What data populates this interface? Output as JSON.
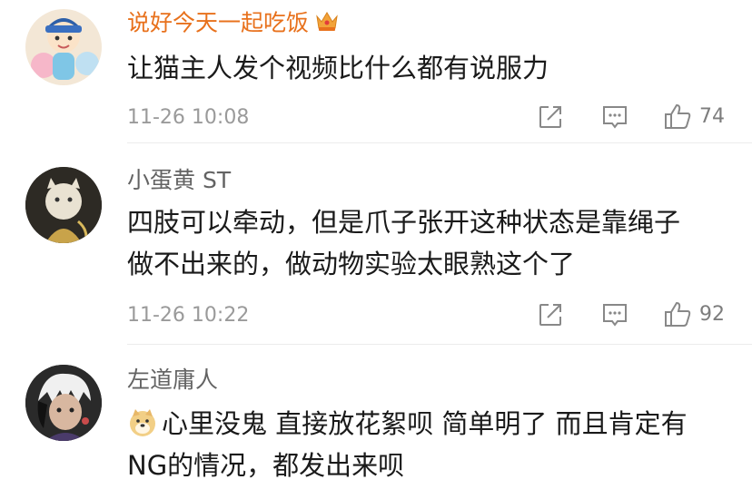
{
  "comments": [
    {
      "username": "说好今天一起吃饭",
      "text_lines": [
        "让猫主人发个视频比什么都有说服力"
      ],
      "timestamp": "11-26 10:08",
      "likes": "74",
      "vip": true
    },
    {
      "username": "小蛋黄 ST",
      "text_lines": [
        "四肢可以牵动，但是爪子张开这种状态是靠绳子",
        "做不出来的，做动物实验太眼熟这个了"
      ],
      "timestamp": "11-26 10:22",
      "likes": "92",
      "vip": false
    },
    {
      "username": "左道庸人",
      "text_lines": [
        "心里没鬼 直接放花絮呗 简单明了 而且肯定有",
        "NG的情况，都发出来呗"
      ],
      "vip": false
    }
  ],
  "icons": {
    "share": "share-icon",
    "comment": "comment-icon",
    "like": "thumbs-up-icon",
    "crown": "crown-icon",
    "emoji": "doge-emoji-icon"
  },
  "colors": {
    "vip_name": "#e8711c",
    "name": "#636363",
    "meta": "#9a9a9a"
  }
}
